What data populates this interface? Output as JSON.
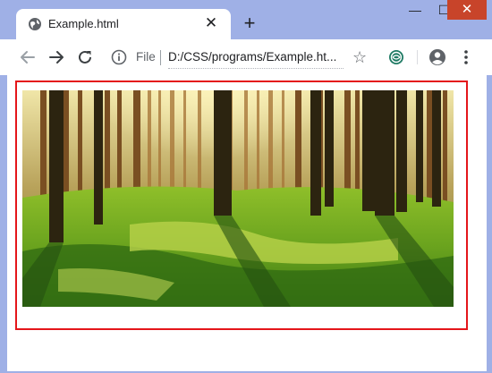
{
  "tab": {
    "title": "Example.html",
    "close_glyph": "✕"
  },
  "new_tab_glyph": "+",
  "window_controls": {
    "minimize": "—",
    "maximize": "☐",
    "close": "✕"
  },
  "toolbar": {
    "scheme_label": "File",
    "url": "D:/CSS/programs/Example.ht...",
    "star_glyph": "☆"
  },
  "icons": {
    "favicon": "globe-icon",
    "back": "back-arrow-icon",
    "forward": "forward-arrow-icon",
    "reload": "reload-icon",
    "info": "info-icon",
    "extension": "extension-icon",
    "profile": "profile-icon",
    "menu": "kebab-menu-icon"
  },
  "colors": {
    "frame_border": "#e4161a",
    "chrome_frame": "#9fb0e6",
    "window_close": "#c8442a"
  },
  "image": {
    "subject": "forest-photo"
  }
}
